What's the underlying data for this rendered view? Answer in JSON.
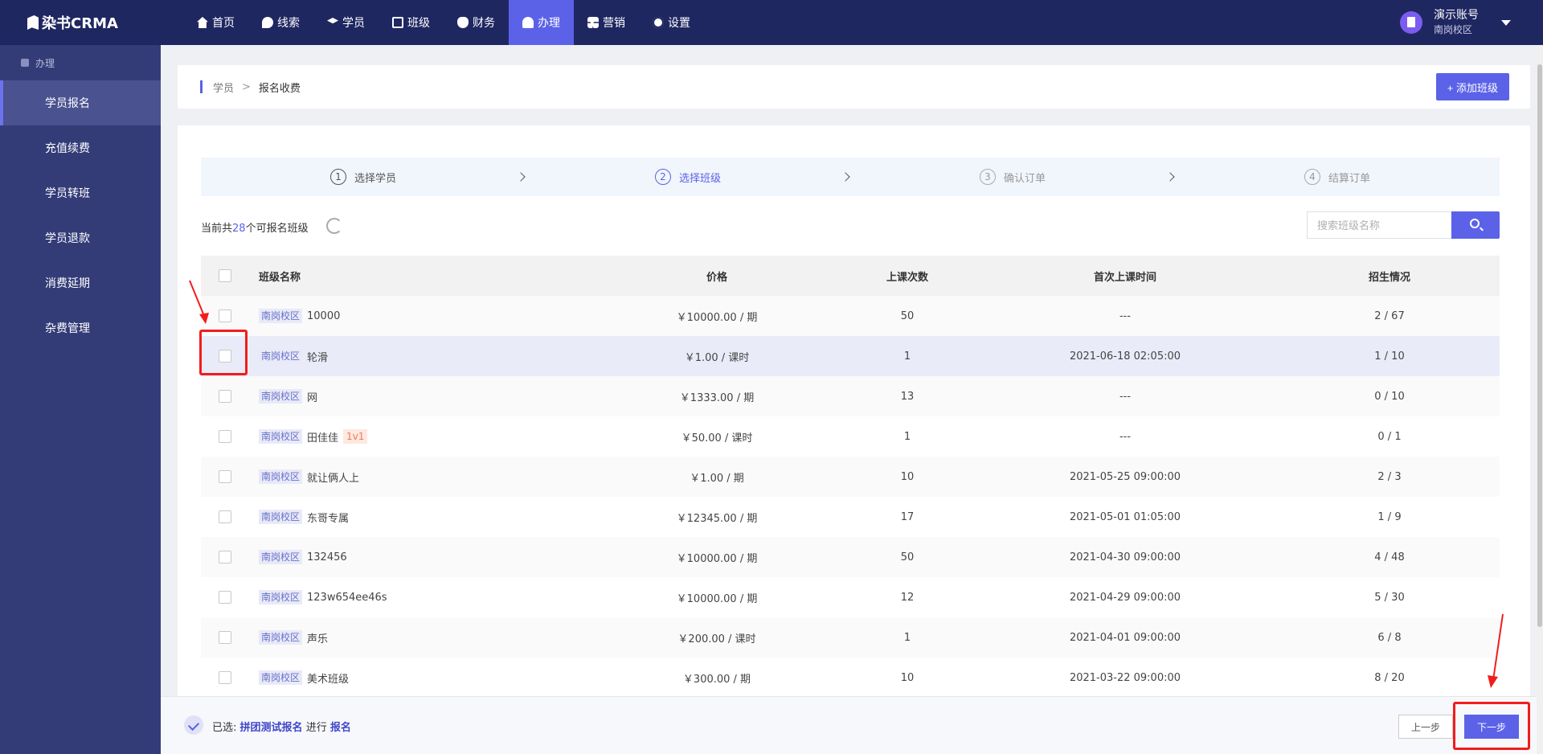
{
  "app": {
    "logo": "染书CRMA"
  },
  "nav": {
    "items": [
      {
        "label": "首页",
        "icon": "home-icon"
      },
      {
        "label": "线索",
        "icon": "clue-icon"
      },
      {
        "label": "学员",
        "icon": "student-icon"
      },
      {
        "label": "班级",
        "icon": "class-icon"
      },
      {
        "label": "财务",
        "icon": "finance-icon"
      },
      {
        "label": "办理",
        "icon": "handle-icon",
        "active": true
      },
      {
        "label": "营销",
        "icon": "marketing-icon"
      },
      {
        "label": "设置",
        "icon": "settings-icon"
      }
    ]
  },
  "account": {
    "name": "演示账号",
    "campus": "南岗校区"
  },
  "sidebar": {
    "section": "办理",
    "items": [
      {
        "label": "学员报名",
        "active": true
      },
      {
        "label": "充值续费"
      },
      {
        "label": "学员转班"
      },
      {
        "label": "学员退款"
      },
      {
        "label": "消费延期"
      },
      {
        "label": "杂费管理"
      }
    ]
  },
  "breadcrumb": {
    "parent": "学员",
    "sep": ">",
    "current": "报名收费"
  },
  "add_class_button": "+ 添加班级",
  "steps": [
    {
      "num": "1",
      "label": "选择学员",
      "state": "done"
    },
    {
      "num": "2",
      "label": "选择班级",
      "state": "active"
    },
    {
      "num": "3",
      "label": "确认订单",
      "state": "pending"
    },
    {
      "num": "4",
      "label": "结算订单",
      "state": "pending"
    }
  ],
  "list_info": {
    "prefix": "当前共",
    "count": "28",
    "suffix": "个可报名班级"
  },
  "search": {
    "placeholder": "搜索班级名称"
  },
  "table": {
    "headers": {
      "name": "班级名称",
      "price": "价格",
      "times": "上课次数",
      "first": "首次上课时间",
      "enroll": "招生情况"
    },
    "rows": [
      {
        "tag": "南岗校区",
        "name": "10000",
        "extra": "",
        "price": "￥10000.00 / 期",
        "times": "50",
        "first": "---",
        "enroll": "2 / 67"
      },
      {
        "tag": "南岗校区",
        "name": "轮滑",
        "extra": "",
        "price": "￥1.00 / 课时",
        "times": "1",
        "first": "2021-06-18 02:05:00",
        "enroll": "1 / 10"
      },
      {
        "tag": "南岗校区",
        "name": "网",
        "extra": "",
        "price": "￥1333.00 / 期",
        "times": "13",
        "first": "---",
        "enroll": "0 / 10"
      },
      {
        "tag": "南岗校区",
        "name": "田佳佳",
        "extra": "1v1",
        "price": "￥50.00 / 课时",
        "times": "1",
        "first": "---",
        "enroll": "0 / 1"
      },
      {
        "tag": "南岗校区",
        "name": "就让俩人上",
        "extra": "",
        "price": "￥1.00 / 期",
        "times": "10",
        "first": "2021-05-25 09:00:00",
        "enroll": "2 / 3"
      },
      {
        "tag": "南岗校区",
        "name": "东哥专属",
        "extra": "",
        "price": "￥12345.00 / 期",
        "times": "17",
        "first": "2021-05-01 01:05:00",
        "enroll": "1 / 9"
      },
      {
        "tag": "南岗校区",
        "name": "132456",
        "extra": "",
        "price": "￥10000.00 / 期",
        "times": "50",
        "first": "2021-04-30 09:00:00",
        "enroll": "4 / 48"
      },
      {
        "tag": "南岗校区",
        "name": "123w654ee46s",
        "extra": "",
        "price": "￥10000.00 / 期",
        "times": "12",
        "first": "2021-04-29 09:00:00",
        "enroll": "5 / 30"
      },
      {
        "tag": "南岗校区",
        "name": "声乐",
        "extra": "",
        "price": "￥200.00 / 课时",
        "times": "1",
        "first": "2021-04-01 09:00:00",
        "enroll": "6 / 8"
      },
      {
        "tag": "南岗校区",
        "name": "美术班级",
        "extra": "",
        "price": "￥300.00 / 期",
        "times": "10",
        "first": "2021-03-22 09:00:00",
        "enroll": "8 / 20"
      }
    ]
  },
  "footer": {
    "selected_label": "已选:",
    "student": "拼团测试报名",
    "mid": "进行",
    "action": "报名",
    "prev": "上一步",
    "next": "下一步"
  },
  "colors": {
    "accent": "#5b62e8",
    "nav_bg": "#1f2761",
    "sidebar_bg": "#343c78",
    "annotation": "#f21c1c"
  }
}
